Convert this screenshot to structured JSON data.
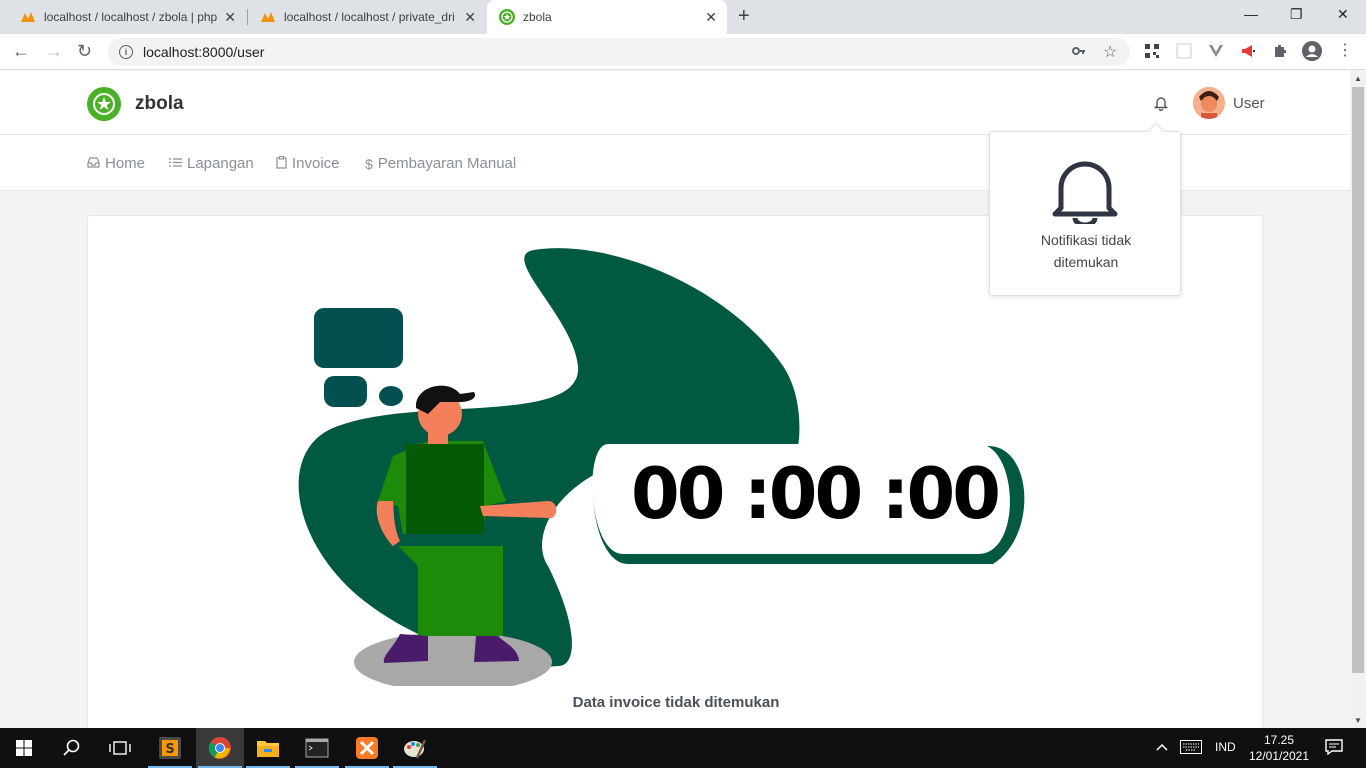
{
  "browser": {
    "tabs": [
      {
        "title": "localhost / localhost / zbola | php"
      },
      {
        "title": "localhost / localhost / private_dri"
      },
      {
        "title": "zbola"
      }
    ],
    "url": "localhost:8000/user"
  },
  "app": {
    "brand": "zbola",
    "user_label": "User",
    "menu": [
      {
        "label": "Home"
      },
      {
        "label": "Lapangan"
      },
      {
        "label": "Invoice"
      },
      {
        "label": "Pembayaran Manual"
      }
    ],
    "notification": {
      "line1": "Notifikasi tidak",
      "line2": "ditemukan"
    },
    "illustration_timer": "00 :00 :00",
    "empty_message": "Data invoice tidak ditemukan"
  },
  "taskbar": {
    "language": "IND",
    "time": "17.25",
    "date": "12/01/2021"
  },
  "colors": {
    "brand_green": "#4caf28",
    "blob_green": "#005940"
  }
}
